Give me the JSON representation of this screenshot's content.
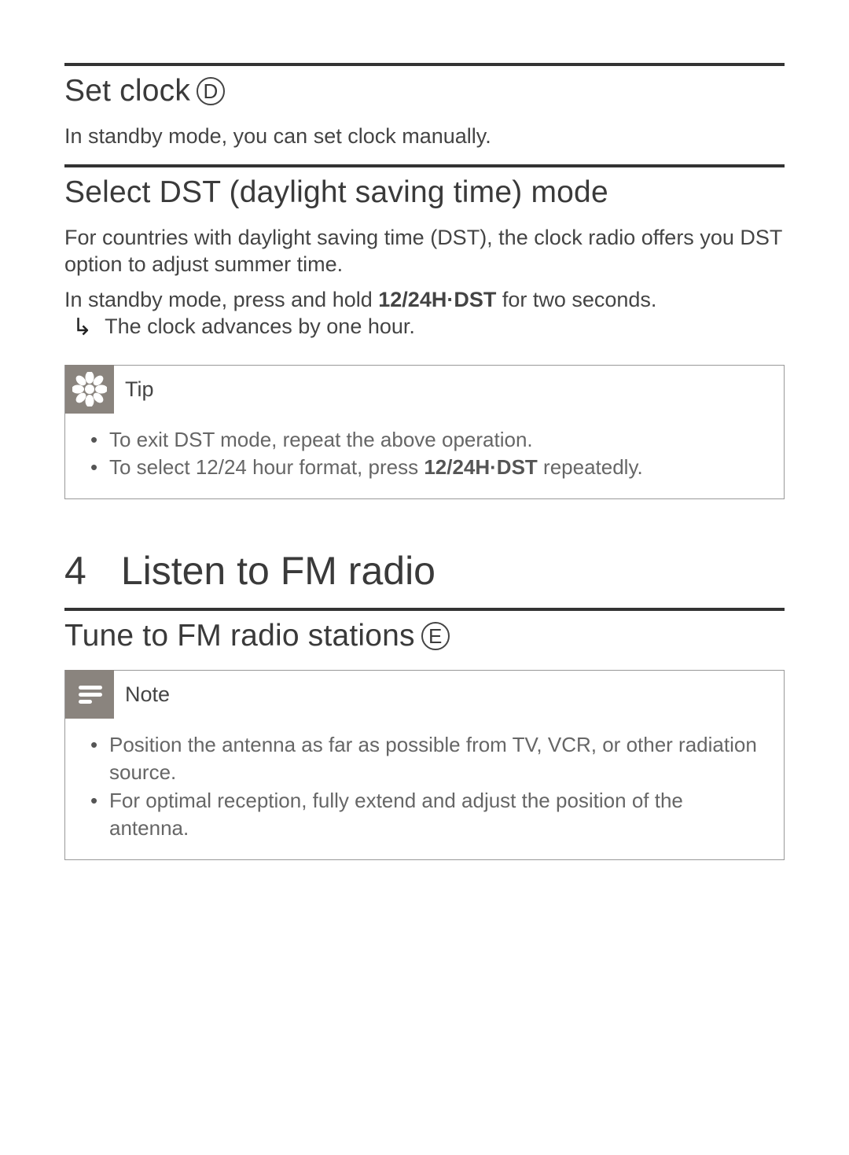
{
  "sections": {
    "set_clock": {
      "heading": "Set clock",
      "ref_letter": "D",
      "body": "In standby mode, you can set clock manually."
    },
    "dst": {
      "heading": "Select DST (daylight saving time) mode",
      "para": "For countries with daylight saving time (DST), the clock radio offers you DST option to adjust summer time.",
      "instr_pre": "In standby mode, press and hold ",
      "instr_btn": "12/24H·DST",
      "instr_post": " for two seconds.",
      "result": "The clock advances by one hour."
    },
    "tip": {
      "label": "Tip",
      "items": [
        {
          "text": "To exit DST mode, repeat the above operation."
        },
        {
          "pre": "To select 12/24 hour format, press ",
          "btn": "12/24H·DST",
          "post": " repeatedly."
        }
      ]
    },
    "chapter4": {
      "num": "4",
      "title": "Listen to FM radio"
    },
    "tune": {
      "heading": "Tune to FM radio stations",
      "ref_letter": "E"
    },
    "note": {
      "label": "Note",
      "items": [
        {
          "text": "Position the antenna as far as possible from TV, VCR, or other radiation source."
        },
        {
          "text": "For optimal reception, fully extend and adjust the position of the antenna."
        }
      ]
    }
  }
}
